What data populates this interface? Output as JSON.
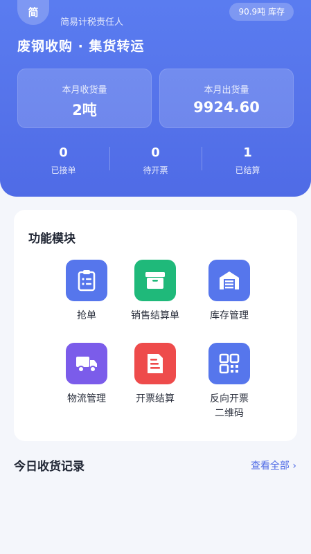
{
  "header": {
    "avatar_text": "简",
    "role": "简易计税责任人",
    "stock_badge": "90.9吨 库存",
    "company": "废钢收购 · 集货转运"
  },
  "stats": [
    {
      "label": "本月收货量",
      "value": "2吨"
    },
    {
      "label": "本月出货量",
      "value": "9924.60"
    }
  ],
  "counters": [
    {
      "value": "0",
      "label": "已接单"
    },
    {
      "value": "0",
      "label": "待开票"
    },
    {
      "value": "1",
      "label": "已结算"
    }
  ],
  "modules": {
    "title": "功能模块",
    "items": [
      {
        "label": "抢单",
        "icon": "clipboard-list-icon",
        "color": "#5676ec"
      },
      {
        "label": "销售结算单",
        "icon": "box-icon",
        "color": "#1fb97a"
      },
      {
        "label": "库存管理",
        "icon": "warehouse-icon",
        "color": "#5676ec"
      },
      {
        "label": "物流管理",
        "icon": "truck-icon",
        "color": "#7b5cea"
      },
      {
        "label": "开票结算",
        "icon": "invoice-icon",
        "color": "#ee4b4b"
      },
      {
        "label": "反向开票\n二维码",
        "icon": "qr-code-icon",
        "color": "#5676ec"
      }
    ]
  },
  "recent": {
    "title": "今日收货记录",
    "view_all": "查看全部 ›"
  }
}
